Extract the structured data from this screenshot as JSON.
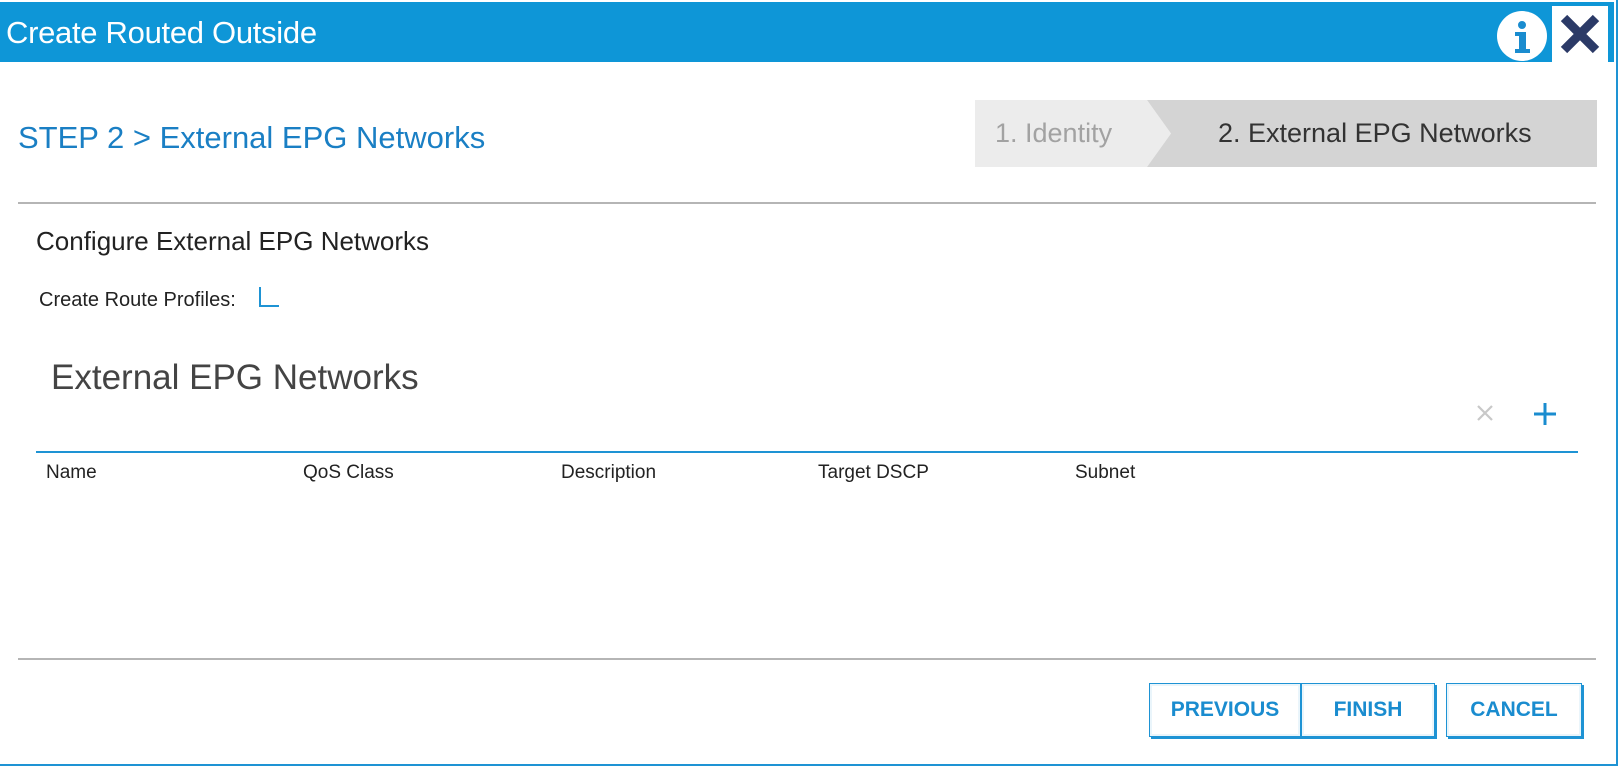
{
  "dialog": {
    "title": "Create Routed Outside",
    "info_icon": "info-icon",
    "close_icon": "close-icon"
  },
  "step": {
    "title": "STEP 2 > External EPG Networks"
  },
  "wizard": {
    "steps": [
      {
        "label": "1. Identity",
        "active": false
      },
      {
        "label": "2. External EPG Networks",
        "active": true
      }
    ]
  },
  "section": {
    "title": "Configure External EPG Networks",
    "route_profiles_label": "Create Route Profiles:",
    "route_profiles_checked": false
  },
  "table": {
    "title": "External EPG Networks",
    "columns": [
      "Name",
      "QoS Class",
      "Description",
      "Target DSCP",
      "Subnet"
    ],
    "rows": []
  },
  "buttons": {
    "previous": "PREVIOUS",
    "finish": "FINISH",
    "cancel": "CANCEL"
  },
  "colors": {
    "titlebar": "#0e96d7",
    "accent": "#1a7fc4",
    "close_x": "#2b3a67",
    "wizard_inactive": "#ececec",
    "wizard_active": "#d4d4d4"
  }
}
